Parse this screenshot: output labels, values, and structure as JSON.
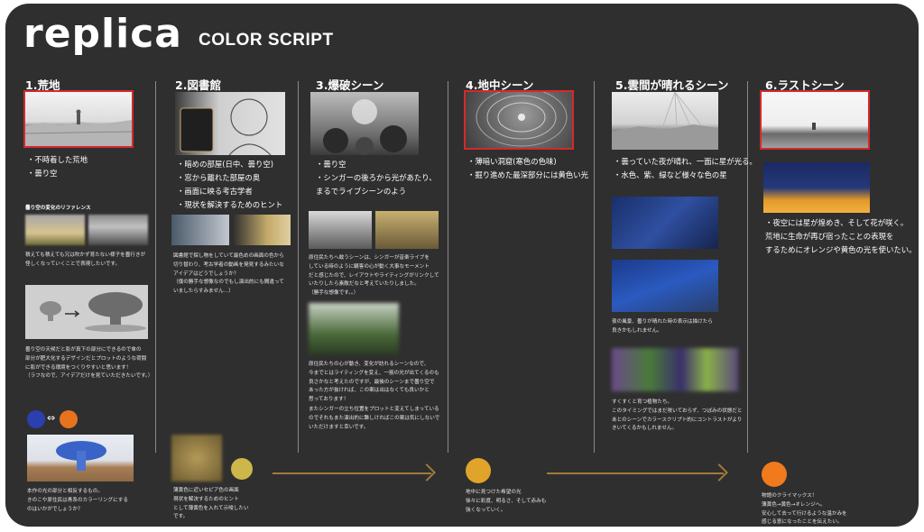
{
  "header": {
    "logo": "replica",
    "subtitle": "COLOR SCRIPT"
  },
  "columns": [
    {
      "title": "1.荒地",
      "lines": [
        "・不時着した荒地",
        "・曇り空"
      ],
      "ref_title": "曇り空の変化のリファレンス",
      "note1": "積えても積えても冗は吹かず育たない様子を曇行きが\n怪しくなっていくことで表現したいです。",
      "note2": "曇り空の天候だと影が真下の部分にできるので傘の\n部分が肥大化するデザインだとプロットのような荷闘\nに影ができる環境をつくりやすいと思います！\n（ラフなので、アイデアだけを見ていただきたいです。）",
      "note3": "本作の光の部分と相反するもの。\nきのこや原住民は青系のカラーリングにする\nのはいかがでしょうか？"
    },
    {
      "title": "2.図書館",
      "lines": [
        "・暗めの部屋(日中、曇り空)",
        "・窓から離れた部屋の奥",
        "・画面に映る考古学者",
        "・現状を解決するためのヒント"
      ],
      "note1": "図書館で探し物をしていて最色めの画面の色から\n切り替わり、考古学者の動画を発見するみたいな\nアイデアはどうでしょうか？\n（僕の勝手な想像なのでもし演出的にも間違って\nいましたらすみません…）",
      "note2": "薄黄色に近いセピア色の画面\n現状を解決するためのヒント\nとして薄黄色を入れて示唆したい\nです。"
    },
    {
      "title": "3.爆破シーン",
      "lines": [
        "・曇り空",
        "・シンガーの後ろから光があたり、",
        "まるでライブシーンのよう"
      ],
      "note1": "原住民たちへ敢うシーンは、シンガーが音楽ライブを\nしている時のように観客の心が動く大事なモーメント\nだと感じたので、レイアウトやライティングがリンクして\nいたりしたら素敵だなと考えていたりしました。\n（勝手な想像です。。）",
      "note2": "原住民たちの心が動き、変化が訪れるシーンなので、\n今までとはライティングを変え、一筋の光が出てくるのも\n良さかなと考えたのですが、最後のシーンまで曇り空で\nあった方が抜ければ、この案は出はなくても良いかと\n思っております！",
      "note3": "またシンガーの立ち位置をプロットと変えてしまっている\nのでそれもまた演出的に難しければこの案は気にしないで\nいただけますと幸いです。"
    },
    {
      "title": "4.地中シーン",
      "lines": [
        "・薄暗い洞窟(寒色の色味)",
        "・掘り進めた最深部分には黄色い光"
      ],
      "note1": "地中に見つけた希望の光\n徐々に彩度、明るさ、そして赤みも\n強くなっていく。"
    },
    {
      "title": "5.雲間が晴れるシーン",
      "lines": [
        "・曇っていた夜が晴れ、一面に星が光る。",
        "・水色、紫、緑など様々な色の星"
      ],
      "note1": "夜の風景、曇りが晴れた時の表示は描けたら\n良きかもしれません。",
      "note2": "すくすくと育つ植物たち。\nこのタイミングではまだ咲いておらず、つぼみの状態だと\nあとのシーンでカラースクリプト的にコントラストがより\nきいてくるかもしれません。"
    },
    {
      "title": "6.ラストシーン",
      "lines": [
        "・夜空には星が煌めき、そして花が咲く。",
        "荒地に生命が再び宿ったことの表現を",
        "するためにオレンジや黄色の光を使いたい。"
      ],
      "note1": "物語のクライマックス！\n薄黄色→黄色→オレンジへ。\n安心して去って行けるような温かみを\n感じる意になったことを伝えたい。"
    }
  ],
  "colors": {
    "board": "#2f2f2f",
    "red_frame": "#d42a2a",
    "blue_dot": "#2b3fae",
    "orange_dot": "#e8731f",
    "sepia_dot": "#cdb64a",
    "yellow_dot": "#e0a42a",
    "final_dot": "#f07a1c",
    "arrow": "#a07a3a"
  },
  "swap_icon": "⇔"
}
